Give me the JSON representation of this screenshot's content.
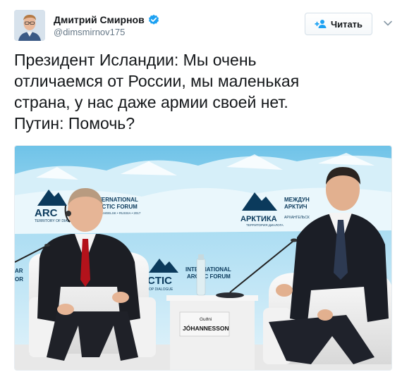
{
  "user": {
    "display_name": "Дмитрий Смирнов",
    "handle": "@dimsmirnov175",
    "verified_icon": "verified-badge-icon"
  },
  "follow": {
    "label": "Читать",
    "icon": "follow-plus-icon"
  },
  "menu": {
    "icon": "chevron-down-icon"
  },
  "tweet": {
    "lines": [
      "Президент Исландии: Мы очень",
      "отличаемся от России, мы маленькая",
      "страна, у нас даже армии своей нет.",
      "Путин: Помочь?"
    ]
  },
  "photo": {
    "backdrop_left": {
      "line1": "INTERNATIONAL",
      "line2": "ARCTIC FORUM",
      "logo": "ARC",
      "sub": "TERRITORY OF DIALOGUE",
      "place": "ARKHANGELSK • RUSSIA • 2017"
    },
    "backdrop_center": {
      "logo": "АРКТИКА",
      "line1": "МЕЖДУН",
      "line2": "АРКТИЧ",
      "place": "АРХАНГЕЛЬСК",
      "sub": "ТЕРРИТОРИЯ ДИАЛОГА"
    },
    "backdrop_lower": {
      "line1": "INTERNATIONAL",
      "line2": "ARCTIC FORUM",
      "logo": "CTIC",
      "sub": "OP DIALOGUE",
      "edge_left": "AR",
      "edge_left2": "OR"
    },
    "nameplate": {
      "first": "Guðni",
      "last": "JÓHANNESSON"
    }
  },
  "colors": {
    "verified": "#1da1f2",
    "follow_icon": "#1da1f2",
    "tie": "#b3121b",
    "backdrop": "#bfe3f3",
    "logo_dark": "#0b3a5c"
  }
}
